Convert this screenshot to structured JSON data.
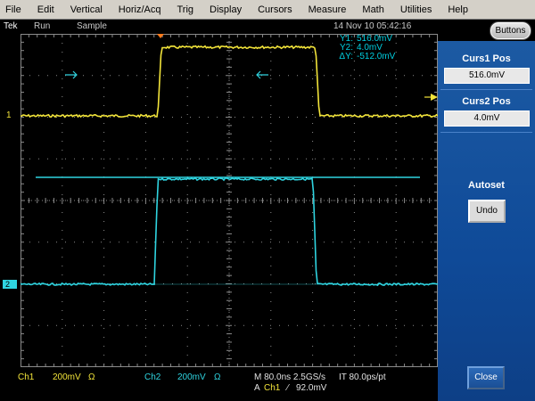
{
  "menu": [
    "File",
    "Edit",
    "Vertical",
    "Horiz/Acq",
    "Trig",
    "Display",
    "Cursors",
    "Measure",
    "Math",
    "Utilities",
    "Help"
  ],
  "status": {
    "brand": "Tek",
    "state": "Run",
    "mode": "Sample",
    "datetime": "14 Nov 10 05:42:16",
    "buttons_label": "Buttons"
  },
  "cursor_readout": {
    "y1_label": "Y1:",
    "y1_value": "516.0mV",
    "y2_label": "Y2:",
    "y2_value": "4.0mV",
    "dy_label": "ΔY:",
    "dy_value": "-512.0mV"
  },
  "channel_markers": {
    "ch1": "1",
    "ch2": "2"
  },
  "right_panel": {
    "curs1_title": "Curs1 Pos",
    "curs1_value": "516.0mV",
    "curs2_title": "Curs2 Pos",
    "curs2_value": "4.0mV",
    "autoset_title": "Autoset",
    "undo_label": "Undo",
    "close_label": "Close"
  },
  "bottom": {
    "ch1_label": "Ch1",
    "ch1_scale": "200mV",
    "ch1_coupling": "Ω",
    "ch2_label": "Ch2",
    "ch2_scale": "200mV",
    "ch2_coupling": "Ω",
    "timebase": "M 80.0ns 2.5GS/s",
    "interp": "IT 80.0ps/pt",
    "trig_mode": "A",
    "trig_source": "Ch1",
    "trig_slope": "⁄",
    "trig_level": "92.0mV"
  },
  "colors": {
    "ch1": "#f2e43a",
    "ch2": "#2fd4e0",
    "cursor": "#2fd4e0",
    "grid": "#8a8a8a",
    "panel": "#1c5aa3"
  }
}
